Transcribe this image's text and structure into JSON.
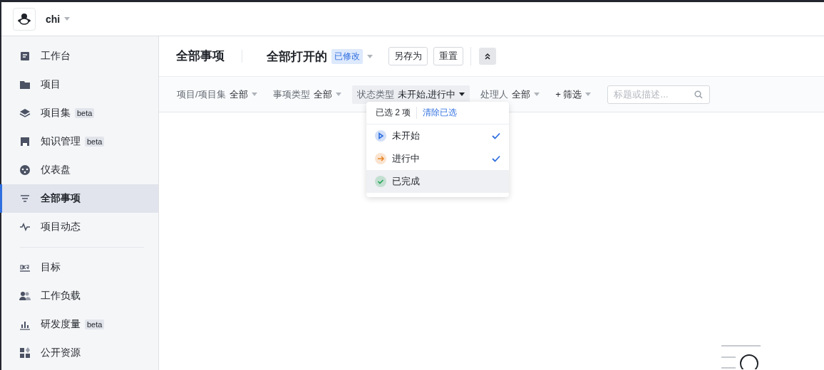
{
  "header": {
    "workspace": "chi"
  },
  "sidebar": {
    "groups": [
      [
        {
          "label": "工作台",
          "selected": false
        },
        {
          "label": "项目",
          "selected": false
        },
        {
          "label": "项目集",
          "badge": "beta",
          "selected": false
        },
        {
          "label": "知识管理",
          "badge": "beta",
          "selected": false
        },
        {
          "label": "仪表盘",
          "selected": false
        },
        {
          "label": "全部事项",
          "selected": true
        },
        {
          "label": "项目动态",
          "selected": false
        }
      ],
      [
        {
          "label": "目标",
          "selected": false
        },
        {
          "label": "工作负载",
          "selected": false
        },
        {
          "label": "研发度量",
          "badge": "beta",
          "selected": false
        },
        {
          "label": "公开资源",
          "selected": false
        }
      ]
    ]
  },
  "page": {
    "title": "全部事项",
    "view": {
      "name": "全部打开的",
      "tag": "已修改"
    },
    "buttons": [
      "另存为",
      "重置"
    ]
  },
  "filters": [
    {
      "label": "项目/项目集",
      "value": "全部",
      "open": false
    },
    {
      "label": "事项类型",
      "value": "全部",
      "open": false
    },
    {
      "label": "状态类型",
      "value": "未开始,进行中",
      "open": true
    },
    {
      "label": "处理人",
      "value": "全部",
      "open": false
    }
  ],
  "add_filter": "+ 筛选",
  "search": {
    "placeholder": "标题或描述..."
  },
  "dropdown": {
    "summary": "已选 2 项",
    "clear": "清除已选",
    "options": [
      {
        "label": "未开始",
        "kind": "play",
        "color": "#2f6fe0",
        "checked": true,
        "highlighted": false
      },
      {
        "label": "进行中",
        "kind": "arrow",
        "color": "#e8862a",
        "checked": true,
        "highlighted": false
      },
      {
        "label": "已完成",
        "kind": "check",
        "color": "#27a55a",
        "checked": false,
        "highlighted": true
      }
    ]
  }
}
